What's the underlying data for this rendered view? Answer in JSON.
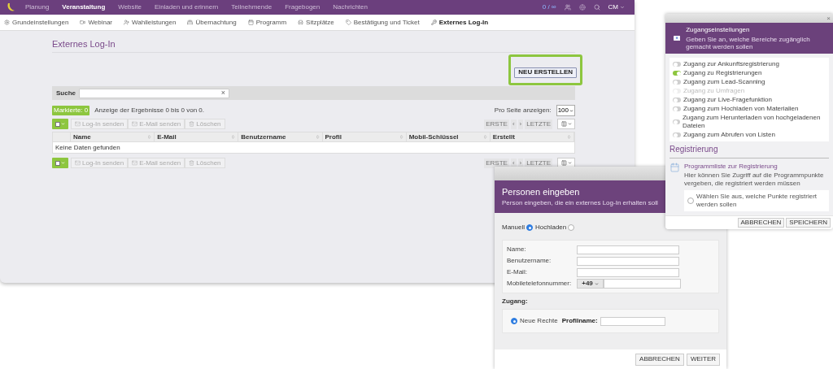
{
  "main_window": {
    "nav": {
      "items": [
        {
          "label": "Planung",
          "selected": false
        },
        {
          "label": "Veranstaltung",
          "selected": true
        },
        {
          "label": "Website",
          "selected": false
        },
        {
          "label": "Einladen und erinnern",
          "selected": false
        },
        {
          "label": "Teilnehmende",
          "selected": false
        },
        {
          "label": "Fragebogen",
          "selected": false
        },
        {
          "label": "Nachrichten",
          "selected": false
        }
      ],
      "counter": "0 / ∞",
      "user": "CM"
    },
    "tabs": [
      {
        "label": "Grundeinstellungen",
        "selected": false
      },
      {
        "label": "Webinar",
        "selected": false
      },
      {
        "label": "Wahlleistungen",
        "selected": false
      },
      {
        "label": "Übernachtung",
        "selected": false
      },
      {
        "label": "Programm",
        "selected": false
      },
      {
        "label": "Sitzplätze",
        "selected": false
      },
      {
        "label": "Bestätigung und Ticket",
        "selected": false
      },
      {
        "label": "Externes Log-In",
        "selected": true
      }
    ],
    "page_title": "Externes Log-In",
    "create_button": "NEU ERSTELLEN",
    "search": {
      "label": "Suche",
      "clear": "×"
    },
    "marked_badge": "Markierte: 0",
    "results_text": "Anzeige der Ergebnisse 0 bis 0 von 0.",
    "per_page": {
      "label": "Pro Seite anzeigen:",
      "value": "100"
    },
    "toolbars": [
      {
        "actions": [
          "Log-In senden",
          "E-Mail senden",
          "Löschen"
        ],
        "pager": [
          "ERSTE",
          "‹",
          "›",
          "LETZTE"
        ]
      },
      {
        "actions": [
          "Log-In senden",
          "E-Mail senden",
          "Löschen"
        ],
        "pager": [
          "ERSTE",
          "‹",
          "›",
          "LETZTE"
        ]
      }
    ],
    "table": {
      "columns": [
        "Name",
        "E-Mail",
        "Benutzername",
        "Profil",
        "Mobil-Schlüssel",
        "Erstellt"
      ],
      "empty_text": "Keine Daten gefunden"
    }
  },
  "person_dialog": {
    "title": "Personen eingeben",
    "subtitle": "Person eingeben, die ein externes Log-In erhalten soll",
    "modes": [
      {
        "label": "Manuell",
        "selected": true
      },
      {
        "label": "Hochladen",
        "selected": false
      }
    ],
    "fields": [
      {
        "label": "Name:"
      },
      {
        "label": "Benutzername:"
      },
      {
        "label": "E-Mail:"
      },
      {
        "label": "Mobiletelefonnummer:",
        "prefix": "+49"
      }
    ],
    "access_label": "Zugang:",
    "access_option": {
      "label": "Neue Rechte",
      "selected": true,
      "profile_label": "Profilname:"
    },
    "buttons": [
      "ABBRECHEN",
      "WEITER"
    ]
  },
  "access_dialog": {
    "close": "×",
    "title": "Zugangseinstellungen",
    "subtitle": "Geben Sie an, welche Bereiche zugänglich gemacht werden sollen",
    "toggles": [
      {
        "label": "Zugang zur Ankunftsregistrierung",
        "on": false,
        "disabled": false
      },
      {
        "label": "Zugang zu Registrierungen",
        "on": true,
        "disabled": false
      },
      {
        "label": "Zugang zum Lead-Scanning",
        "on": false,
        "disabled": false
      },
      {
        "label": "Zugang zu Umfragen",
        "on": false,
        "disabled": true
      },
      {
        "label": "Zugang zur Live-Fragefunktion",
        "on": false,
        "disabled": false
      },
      {
        "label": "Zugang zum Hochladen von Materialien",
        "on": false,
        "disabled": false
      },
      {
        "label": "Zugang zum Herunterladen von hochgeladenen Dateien",
        "on": false,
        "disabled": false
      },
      {
        "label": "Zugang zum Abrufen von Listen",
        "on": false,
        "disabled": false
      }
    ],
    "section_title": "Registrierung",
    "item_title": "Programmliste zur Registrierung",
    "item_text": "Hier können Sie Zugriff auf die Programmpunkte vergeben, die registriert werden müssen",
    "item_option": {
      "label": "Wählen Sie aus, welche Punkte registriert werden sollen",
      "selected": false
    },
    "buttons": [
      "ABBRECHEN",
      "SPEICHERN"
    ]
  }
}
